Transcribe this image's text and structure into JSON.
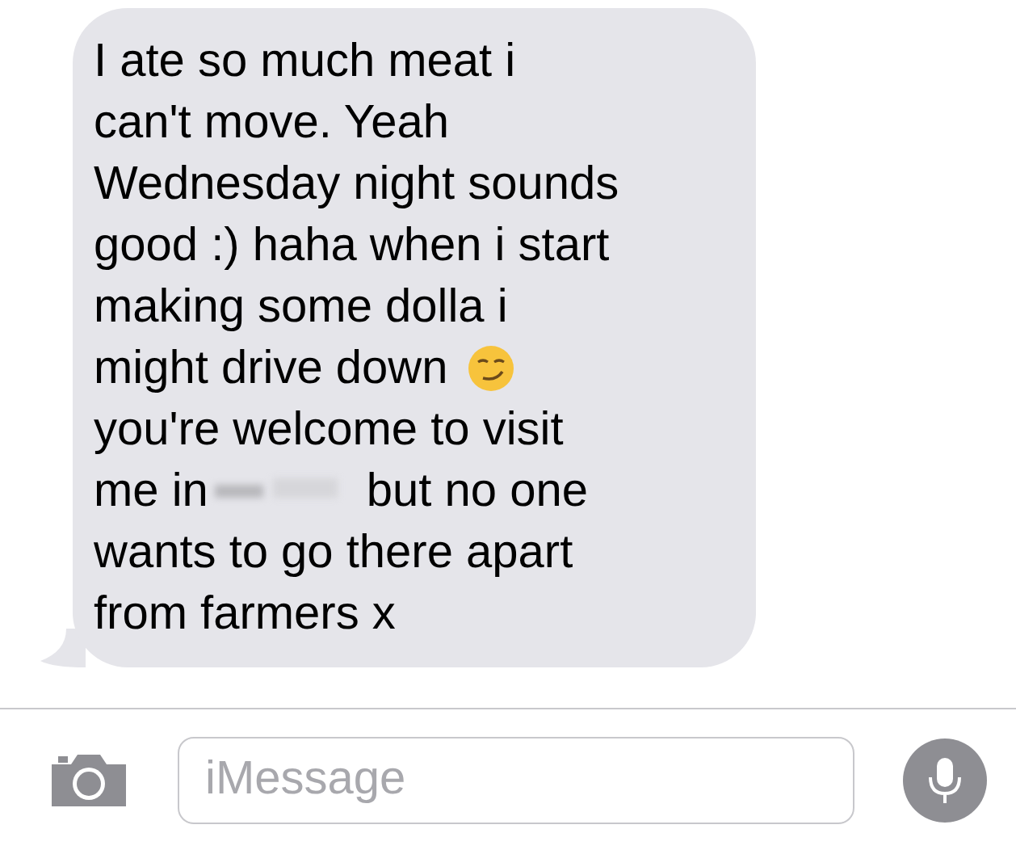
{
  "message": {
    "lines": [
      {
        "parts": [
          {
            "kind": "text",
            "text": "I ate so much meat i"
          }
        ]
      },
      {
        "parts": [
          {
            "kind": "text",
            "text": "can't move. Yeah"
          }
        ]
      },
      {
        "parts": [
          {
            "kind": "text",
            "text": "Wednesday night sounds"
          }
        ]
      },
      {
        "parts": [
          {
            "kind": "text",
            "text": "good :) haha when i start"
          }
        ]
      },
      {
        "parts": [
          {
            "kind": "text",
            "text": "making some dolla i"
          }
        ]
      },
      {
        "parts": [
          {
            "kind": "text",
            "text": "might drive down"
          },
          {
            "kind": "emoji"
          }
        ]
      },
      {
        "parts": [
          {
            "kind": "text",
            "text": "you're welcome to visit"
          }
        ]
      },
      {
        "parts": [
          {
            "kind": "text",
            "text": "me in"
          },
          {
            "kind": "redacted"
          },
          {
            "kind": "text",
            "text": "but no one"
          }
        ]
      },
      {
        "parts": [
          {
            "kind": "text",
            "text": "wants to go there apart"
          }
        ]
      },
      {
        "parts": [
          {
            "kind": "text",
            "text": "from farmers x"
          }
        ]
      }
    ]
  },
  "composer": {
    "placeholder": "iMessage"
  }
}
